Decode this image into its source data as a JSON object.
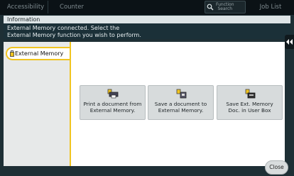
{
  "topbar": {
    "accessibility_label": "Accessibility",
    "counter_label": "Counter",
    "function_search_label_1": "Function",
    "function_search_label_2": "Search",
    "job_list_label": "Job List"
  },
  "info": {
    "header": "Information",
    "message_line1": "External Memory connected. Select the",
    "message_line2": "External Memory function you wish to perform."
  },
  "sidebar": {
    "items": [
      {
        "label": "External Memory"
      }
    ]
  },
  "actions": [
    {
      "line1": "Print a document from",
      "line2": "External Memory."
    },
    {
      "line1": "Save a document to",
      "line2": "External Memory."
    },
    {
      "line1": "Save Ext. Memory",
      "line2": "Doc. in User Box"
    }
  ],
  "footer": {
    "close_label": "Close"
  },
  "colors": {
    "accent_yellow": "#f0c420",
    "panel_dark": "#1e2f35",
    "topbar": "#0b1216"
  }
}
